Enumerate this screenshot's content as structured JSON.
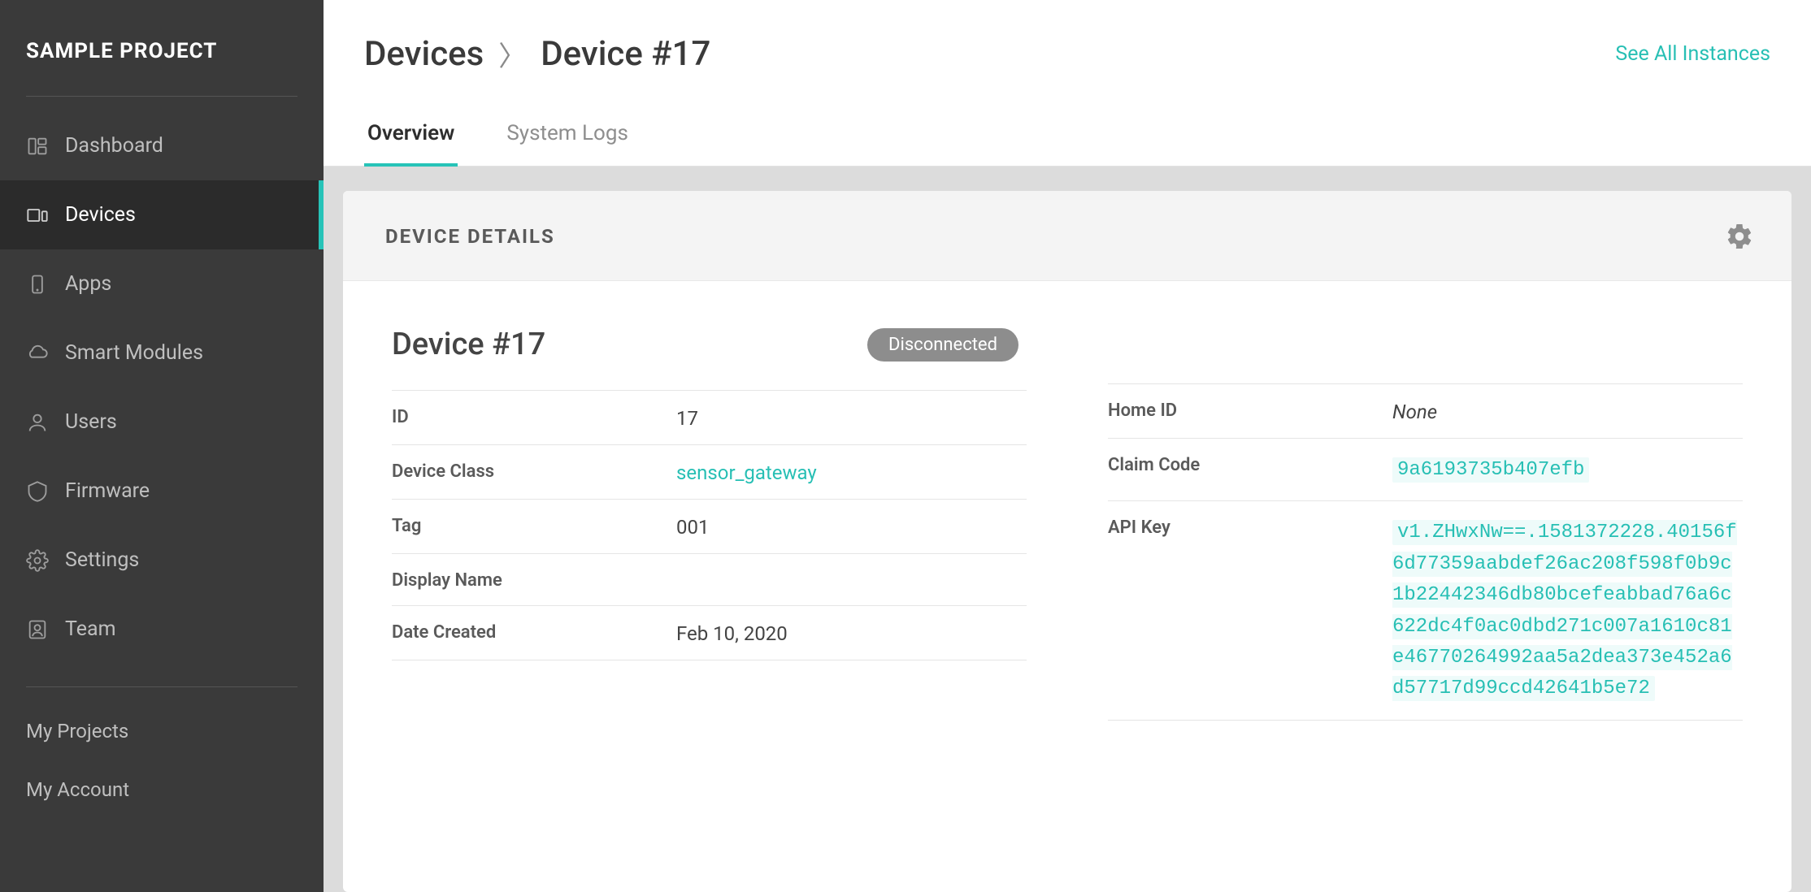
{
  "sidebar": {
    "project_title": "SAMPLE PROJECT",
    "items": [
      {
        "label": "Dashboard",
        "icon": "dashboard"
      },
      {
        "label": "Devices",
        "icon": "devices",
        "active": true
      },
      {
        "label": "Apps",
        "icon": "apps"
      },
      {
        "label": "Smart Modules",
        "icon": "cloud"
      },
      {
        "label": "Users",
        "icon": "user"
      },
      {
        "label": "Firmware",
        "icon": "firmware"
      },
      {
        "label": "Settings",
        "icon": "gear"
      },
      {
        "label": "Team",
        "icon": "team"
      }
    ],
    "footer": [
      {
        "label": "My Projects"
      },
      {
        "label": "My Account"
      }
    ]
  },
  "header": {
    "breadcrumb_root": "Devices",
    "breadcrumb_current": "Device #17",
    "see_all": "See All Instances"
  },
  "tabs": [
    {
      "label": "Overview",
      "active": true
    },
    {
      "label": "System Logs"
    }
  ],
  "panel": {
    "title": "DEVICE DETAILS",
    "device_name": "Device #17",
    "status": "Disconnected",
    "left": [
      {
        "label": "ID",
        "value": "17"
      },
      {
        "label": "Device Class",
        "value": "sensor_gateway",
        "link": true
      },
      {
        "label": "Tag",
        "value": "001"
      },
      {
        "label": "Display Name",
        "value": ""
      },
      {
        "label": "Date Created",
        "value": "Feb 10, 2020"
      }
    ],
    "right": [
      {
        "label": "Home ID",
        "value": "None",
        "italic": true
      },
      {
        "label": "Claim Code",
        "value": "9a6193735b407efb",
        "code": true
      },
      {
        "label": "API Key",
        "value": "v1.ZHwxNw==.1581372228.40156f6d77359aabdef26ac208f598f0b9c1b22442346db80bcefeabbad76a6c622dc4f0ac0dbd271c007a1610c81e46770264992aa5a2dea373e452a6d57717d99ccd42641b5e72",
        "code": true
      }
    ]
  }
}
